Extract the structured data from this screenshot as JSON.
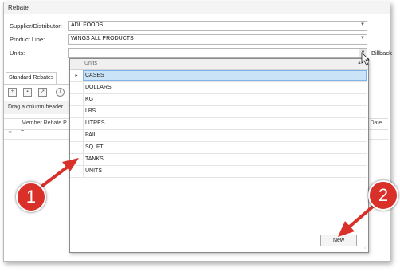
{
  "window": {
    "title": "Rebate"
  },
  "form": {
    "supplier_label": "Supplier/Distributor:",
    "supplier_value": "ADL FOODS",
    "product_line_label": "Product Line:",
    "product_line_value": "WINGS ALL PRODUCTS",
    "units_label": "Units:",
    "units_value": "",
    "billback_label": "Billback"
  },
  "tabs": {
    "standard_rebates": "Standard Rebates"
  },
  "grid": {
    "group_hint": "Drag a column header",
    "col_member": "Member Rebate P",
    "col_right": "y Date"
  },
  "dropdown": {
    "column_header": "Units",
    "items": [
      "CASES",
      "DOLLARS",
      "KG",
      "LBS",
      "LITRES",
      "PAIL",
      "SQ. FT",
      "TANKS",
      "UNITS"
    ],
    "selected_index": 0,
    "new_button": "New"
  },
  "callouts": [
    "1",
    "2"
  ],
  "colors": {
    "callout": "#d9302a",
    "selection": "#cbe3f7"
  },
  "icons": [
    "chevron-down-icon",
    "row-indicator-icon",
    "filter-icon",
    "new-record-icon",
    "save-icon",
    "export-icon",
    "info-icon",
    "sort-up-icon",
    "size-grip-icon",
    "mouse-cursor-icon"
  ]
}
